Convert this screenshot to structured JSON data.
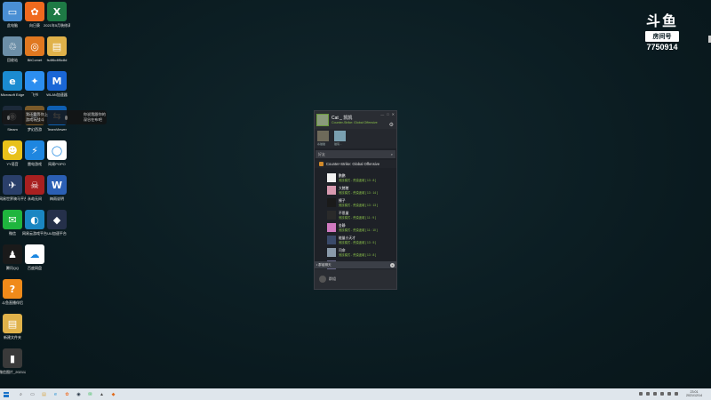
{
  "desktop_icons": [
    {
      "label": "此电脑",
      "glyph": "▭",
      "color": "#4a8fd4",
      "col": 0,
      "row": 0
    },
    {
      "label": "向日葵",
      "glyph": "✿",
      "color": "#f06a1e",
      "col": 1,
      "row": 0
    },
    {
      "label": "2021年5月装修清单_李飞飞",
      "glyph": "X",
      "color": "#1e7a45",
      "col": 2,
      "row": 0
    },
    {
      "label": "回收站",
      "glyph": "♲",
      "color": "#6c8fa8",
      "col": 0,
      "row": 1
    },
    {
      "label": "BitComet",
      "glyph": "◎",
      "color": "#e07820",
      "col": 1,
      "row": 1
    },
    {
      "label": "fs4f6c4f6c8d",
      "glyph": "▤",
      "color": "#e0b24a",
      "col": 2,
      "row": 1
    },
    {
      "label": "Microsoft Edge",
      "glyph": "e",
      "color": "#1b8bd0",
      "col": 0,
      "row": 2
    },
    {
      "label": "飞书",
      "glyph": "✦",
      "color": "#2c8ef0",
      "col": 1,
      "row": 2
    },
    {
      "label": "WLAN加速器",
      "glyph": "M",
      "color": "#1a66d6",
      "col": 2,
      "row": 2
    },
    {
      "label": "Steam",
      "glyph": "◉",
      "color": "#1c2a3a",
      "col": 0,
      "row": 3
    },
    {
      "label": "梦幻西游",
      "glyph": "☗",
      "color": "#7a5a2a",
      "col": 1,
      "row": 3
    },
    {
      "label": "TeamViewer",
      "glyph": "⇆",
      "color": "#0e5fb2",
      "col": 2,
      "row": 3
    },
    {
      "label": "YY语音",
      "glyph": "☻",
      "color": "#e8c11a",
      "col": 0,
      "row": 4
    },
    {
      "label": "雷电游戏",
      "glyph": "⚡",
      "color": "#1e86e0",
      "col": 1,
      "row": 4
    },
    {
      "label": "网易POPO",
      "glyph": "◯",
      "color": "#ffffff",
      "col": 2,
      "row": 4
    },
    {
      "label": "网易世界骑马平台",
      "glyph": "✈",
      "color": "#2a3f6a",
      "col": 0,
      "row": 5
    },
    {
      "label": "永劫无间",
      "glyph": "☠",
      "color": "#a82020",
      "col": 1,
      "row": 5
    },
    {
      "label": "梅雨说明",
      "glyph": "W",
      "color": "#2b5fb4",
      "col": 2,
      "row": 5
    },
    {
      "label": "微信",
      "glyph": "✉",
      "color": "#1fb53e",
      "col": 0,
      "row": 6
    },
    {
      "label": "网易云游戏平台",
      "glyph": "◐",
      "color": "#1a86c2",
      "col": 1,
      "row": 6
    },
    {
      "label": "UU加速平台",
      "glyph": "◆",
      "color": "#25304a",
      "col": 2,
      "row": 6
    },
    {
      "label": "腾讯QQ",
      "glyph": "♟",
      "color": "#1a1a1a",
      "col": 0,
      "row": 7
    },
    {
      "label": "百度网盘",
      "glyph": "☁",
      "color": "#ffffff",
      "col": 1,
      "row": 7
    },
    {
      "label": "斗鱼直播伴侣",
      "glyph": "?",
      "color": "#f08a1a",
      "col": 0,
      "row": 8
    },
    {
      "label": "新建文件夹",
      "glyph": "▤",
      "color": "#e0b24a",
      "col": 0,
      "row": 9
    },
    {
      "label": "微信图片_2021128...",
      "glyph": "▮",
      "color": "#3a3a3a",
      "col": 0,
      "row": 10
    }
  ],
  "tooltip": {
    "left_text": "我还要等你上游戏玩战斗",
    "right_text": "你说我跟你的深谷在布吧"
  },
  "watermark": {
    "logo": "斗鱼",
    "room_label": "房间号",
    "room_number": "7750914"
  },
  "steam": {
    "username": "Cat _ 凯凯",
    "status": "Counter-Strike: Global Offensive",
    "window_buttons": [
      "—",
      "□",
      "✕"
    ],
    "recent": [
      {
        "label": "杀猫猫",
        "color": "#6e6a5a"
      },
      {
        "label": "猫尾...",
        "color": "#7aa0b0"
      }
    ],
    "search_label": "好友",
    "game_section": "Counter-Strike: Global Offensive",
    "friends": [
      {
        "name": "鹏鹏",
        "game": "竞技模式 - 荒漠迷城 [ 13 : 8 ]",
        "avatar": "#f2f2f2"
      },
      {
        "name": "大猪猪",
        "game": "竞技模式 - 荒漠迷城 [ 13 : 14 ]",
        "avatar": "#d89ab0"
      },
      {
        "name": "撩子",
        "game": "竞技模式 - 荒漠迷城 [ 13 : 13 ]",
        "avatar": "#1a1a1a"
      },
      {
        "name": "不思量",
        "game": "竞技模式 - 荒漠迷城 [ 11 : 9 ]",
        "avatar": "#2a2a2a"
      },
      {
        "name": "金静",
        "game": "竞技模式 - 荒漠迷城 [ 11 : 10 ]",
        "avatar": "#d07ac0"
      },
      {
        "name": "能量小天才",
        "game": "竞技模式 - 荒漠迷城 [ 13 : 5 ]",
        "avatar": "#3a4a6a"
      },
      {
        "name": "司命",
        "game": "竞技模式 - 荒漠迷城 [ 13 : 8 ]",
        "avatar": "#8a9aaa"
      },
      {
        "name": "",
        "game": "在 游戏 之 荒漠迷城",
        "avatar": "#6a6a8a"
      }
    ],
    "group_label": "• 群组聊天",
    "chats_label": "群组"
  },
  "taskbar": {
    "apps": [
      {
        "glyph": "⌕",
        "color": "#333333"
      },
      {
        "glyph": "▭",
        "color": "#555555"
      },
      {
        "glyph": "▤",
        "color": "#d8a23a"
      },
      {
        "glyph": "e",
        "color": "#1b8bd0"
      },
      {
        "glyph": "✿",
        "color": "#f06a1e"
      },
      {
        "glyph": "◉",
        "color": "#1c2a3a"
      },
      {
        "glyph": "✉",
        "color": "#1fb53e"
      },
      {
        "glyph": "▲",
        "color": "#4a4a4a"
      },
      {
        "glyph": "◆",
        "color": "#e06a1a"
      }
    ],
    "time": "23:01",
    "date": "2021/12/14"
  }
}
